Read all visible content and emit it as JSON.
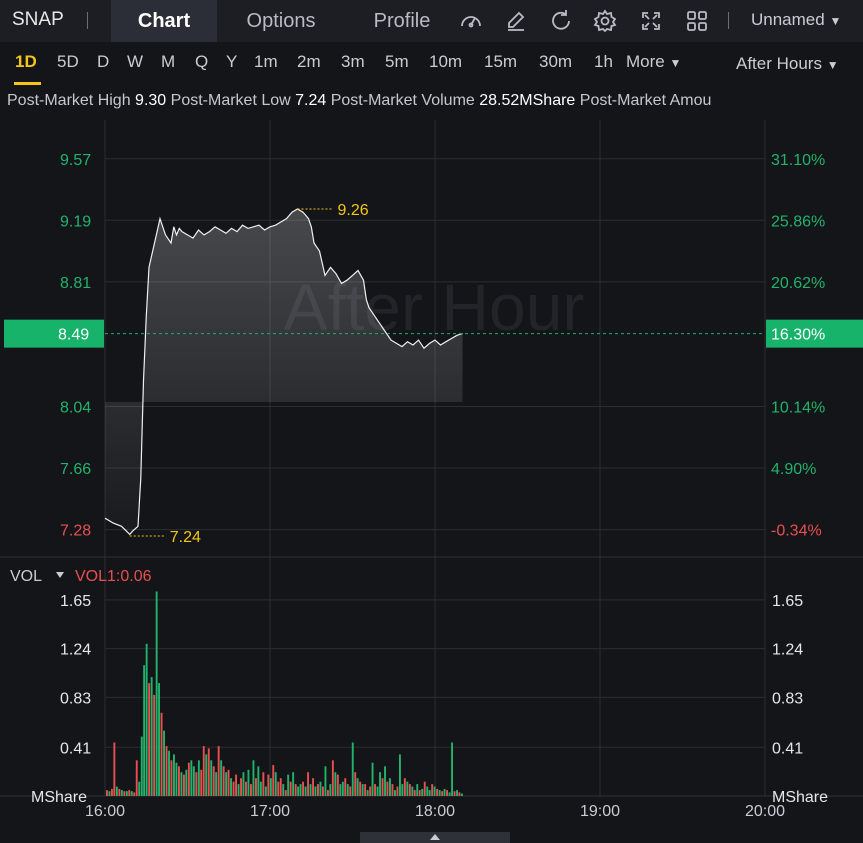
{
  "header": {
    "ticker": "SNAP",
    "tabs": [
      {
        "label": "Chart",
        "active": true
      },
      {
        "label": "Options",
        "active": false
      },
      {
        "label": "Profile",
        "active": false
      }
    ],
    "toolbar_icons": [
      "gauge-icon",
      "edit-icon",
      "refresh-icon",
      "settings-icon",
      "fullscreen-icon",
      "grid-icon"
    ],
    "layout_name": "Unnamed"
  },
  "timeframes": {
    "items": [
      "1D",
      "5D",
      "D",
      "W",
      "M",
      "Q",
      "Y",
      "1m",
      "2m",
      "3m",
      "5m",
      "10m",
      "15m",
      "30m",
      "1h"
    ],
    "active": "1D",
    "more_label": "More",
    "session_label": "After Hours"
  },
  "stats": {
    "high_label": "Post-Market High",
    "high_value": "9.30",
    "low_label": "Post-Market Low",
    "low_value": "7.24",
    "volume_label": "Post-Market Volume",
    "volume_value": "28.52MShare",
    "amount_label": "Post-Market Amou"
  },
  "colors": {
    "up": "#21b36b",
    "down": "#e84f4f",
    "accent": "#f5c518",
    "current": "#17b36b"
  },
  "chart_data": {
    "type": "line",
    "watermark": "After Hour",
    "price_axis": [
      "9.57",
      "9.19",
      "8.81",
      "8.49",
      "8.04",
      "7.66",
      "7.28"
    ],
    "percent_axis": [
      "31.10%",
      "25.86%",
      "20.62%",
      "16.30%",
      "10.14%",
      "4.90%",
      "-0.34%"
    ],
    "current_price": "8.49",
    "current_percent": "16.30%",
    "high_marker": "9.26",
    "low_marker": "7.24",
    "x_ticks": [
      "16:00",
      "17:00",
      "18:00",
      "19:00",
      "20:00"
    ],
    "ylim": [
      7.16,
      9.76
    ],
    "series": [
      {
        "x": [
          0,
          3,
          6,
          9,
          10,
          12,
          13,
          14,
          15,
          16,
          18,
          20,
          22,
          24,
          25,
          26,
          27,
          28,
          30,
          32,
          34,
          36,
          38,
          40,
          42,
          44,
          46,
          48,
          50,
          52,
          54,
          56,
          58,
          60,
          62,
          64,
          66,
          68,
          70,
          72,
          73,
          74,
          75,
          76,
          78,
          80,
          82,
          84,
          86,
          88,
          90,
          92,
          94,
          95,
          96,
          98,
          100,
          102,
          104,
          106,
          108,
          110,
          112,
          114,
          116,
          118,
          120,
          122,
          124,
          126,
          128,
          130
        ],
        "y": [
          7.35,
          7.32,
          7.3,
          7.25,
          7.27,
          7.3,
          7.6,
          8.2,
          8.6,
          8.9,
          9.05,
          9.2,
          9.1,
          9.05,
          9.15,
          9.1,
          9.14,
          9.12,
          9.1,
          9.08,
          9.13,
          9.1,
          9.12,
          9.15,
          9.13,
          9.11,
          9.14,
          9.12,
          9.16,
          9.14,
          9.15,
          9.16,
          9.13,
          9.15,
          9.16,
          9.18,
          9.2,
          9.24,
          9.26,
          9.24,
          9.22,
          9.2,
          9.15,
          9.05,
          9.0,
          8.85,
          8.9,
          8.86,
          8.8,
          8.82,
          8.85,
          8.88,
          8.82,
          8.7,
          8.65,
          8.6,
          8.55,
          8.5,
          8.45,
          8.43,
          8.41,
          8.44,
          8.42,
          8.45,
          8.4,
          8.43,
          8.45,
          8.42,
          8.44,
          8.46,
          8.48,
          8.49
        ]
      }
    ],
    "volume": {
      "label": "VOL",
      "indicator": "VOL1:0.06",
      "axis": [
        "1.65",
        "1.24",
        "0.83",
        "0.41"
      ],
      "unit": "MShare",
      "ylim": [
        0,
        1.8
      ],
      "bars": [
        0.05,
        0.04,
        0.06,
        0.45,
        0.08,
        0.06,
        0.05,
        0.04,
        0.04,
        0.05,
        0.04,
        0.03,
        0.3,
        0.12,
        0.5,
        1.1,
        1.28,
        0.95,
        1.0,
        0.85,
        1.72,
        0.95,
        0.7,
        0.55,
        0.42,
        0.38,
        0.3,
        0.35,
        0.28,
        0.25,
        0.2,
        0.18,
        0.22,
        0.28,
        0.3,
        0.25,
        0.2,
        0.3,
        0.22,
        0.42,
        0.35,
        0.4,
        0.3,
        0.25,
        0.2,
        0.42,
        0.3,
        0.25,
        0.2,
        0.22,
        0.15,
        0.12,
        0.18,
        0.1,
        0.15,
        0.2,
        0.12,
        0.22,
        0.1,
        0.3,
        0.15,
        0.25,
        0.12,
        0.2,
        0.08,
        0.18,
        0.15,
        0.26,
        0.2,
        0.12,
        0.15,
        0.1,
        0.05,
        0.18,
        0.12,
        0.2,
        0.1,
        0.08,
        0.1,
        0.12,
        0.08,
        0.2,
        0.1,
        0.15,
        0.08,
        0.1,
        0.12,
        0.08,
        0.25,
        0.05,
        0.1,
        0.3,
        0.2,
        0.18,
        0.1,
        0.12,
        0.15,
        0.1,
        0.08,
        0.45,
        0.2,
        0.15,
        0.12,
        0.1,
        0.1,
        0.05,
        0.08,
        0.28,
        0.1,
        0.08,
        0.2,
        0.15,
        0.25,
        0.12,
        0.15,
        0.1,
        0.05,
        0.08,
        0.35,
        0.1,
        0.15,
        0.12,
        0.1,
        0.08,
        0.05,
        0.1,
        0.05,
        0.06,
        0.12,
        0.08,
        0.05,
        0.1,
        0.08,
        0.06,
        0.05,
        0.04,
        0.06,
        0.05,
        0.03,
        0.45,
        0.04,
        0.05,
        0.03,
        0.02
      ],
      "bar_dirs": [
        0,
        1,
        0,
        0,
        1,
        0,
        1,
        0,
        1,
        0,
        1,
        0,
        0,
        1,
        1,
        1,
        1,
        0,
        1,
        0,
        1,
        1,
        0,
        1,
        0,
        1,
        0,
        1,
        1,
        0,
        1,
        0,
        1,
        0,
        1,
        1,
        0,
        1,
        0,
        0,
        1,
        0,
        1,
        0,
        1,
        0,
        1,
        0,
        1,
        0,
        1,
        0,
        0,
        1,
        0,
        1,
        0,
        1,
        0,
        1,
        0,
        1,
        1,
        0,
        1,
        0,
        1,
        0,
        1,
        0,
        0,
        1,
        0,
        1,
        0,
        1,
        0,
        1,
        1,
        0,
        1,
        0,
        1,
        0,
        1,
        0,
        1,
        0,
        1,
        0,
        1,
        0,
        1,
        0,
        1,
        1,
        0,
        1,
        0,
        1,
        0,
        1,
        0,
        1,
        0,
        1,
        0,
        1,
        0,
        1,
        1,
        0,
        1,
        0,
        1,
        0,
        1,
        0,
        1,
        1,
        0,
        1,
        0,
        1,
        0,
        1,
        0,
        1,
        0,
        1,
        1,
        0,
        1,
        0,
        1,
        0,
        1,
        0,
        1,
        1,
        0,
        1,
        0,
        1,
        0,
        1
      ]
    }
  }
}
